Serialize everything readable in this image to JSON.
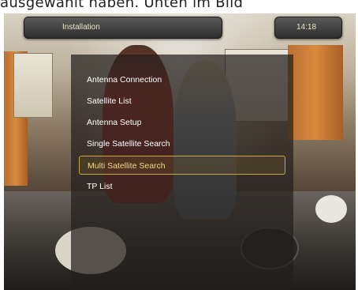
{
  "caption": {
    "text": "ausgewählt haben. Unten im Bild"
  },
  "header": {
    "title": "Installation",
    "clock": "14:18"
  },
  "menu": {
    "items": [
      {
        "label": "Antenna Connection"
      },
      {
        "label": "Satellite List"
      },
      {
        "label": "Antenna Setup"
      },
      {
        "label": "Single Satellite Search"
      },
      {
        "label": "Multi Satellite Search",
        "selected": true
      },
      {
        "label": "TP List"
      }
    ]
  },
  "colors": {
    "highlight_border": "#c9a64a",
    "bar_text": "#f0e6c0"
  }
}
